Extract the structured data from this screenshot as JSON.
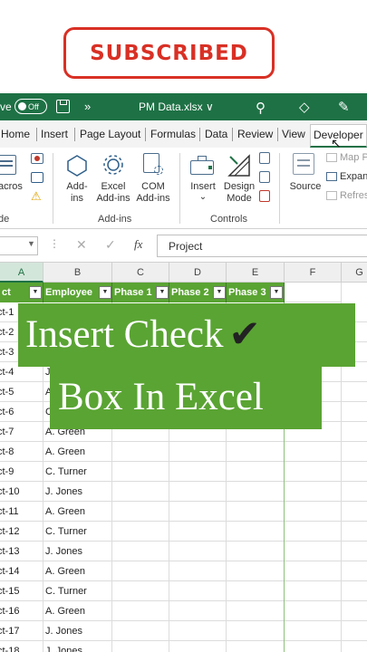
{
  "badge": {
    "label": "SUBSCRIBED"
  },
  "titlebar": {
    "autosave_fragment": "ve",
    "toggle_label": "Off",
    "more_label": "»",
    "filename": "PM Data.xlsx ∨"
  },
  "ribbon": {
    "tabs": [
      "Home",
      "Insert",
      "Page Layout",
      "Formulas",
      "Data",
      "Review",
      "View",
      "Developer"
    ],
    "active_tab": "Developer",
    "code": {
      "macros_fragment": "acros",
      "group_fragment": "de"
    },
    "addins": {
      "addins_label_1": "Add-",
      "addins_label_2": "ins",
      "excel_label_1": "Excel",
      "excel_label_2": "Add-ins",
      "com_label_1": "COM",
      "com_label_2": "Add-ins",
      "group_label": "Add-ins"
    },
    "controls": {
      "insert_label": "Insert",
      "insert_caret": "⌄",
      "design_label_1": "Design",
      "design_label_2": "Mode",
      "group_label": "Controls"
    },
    "xml": {
      "source_label": "Source",
      "map_label": "Map P",
      "expand_label": "Expan",
      "refresh_label": "Refres"
    }
  },
  "formula_bar": {
    "value": "Project",
    "fx": "fx"
  },
  "columns": [
    "A",
    "B",
    "C",
    "D",
    "E",
    "F",
    "G"
  ],
  "table_headers": [
    "ct",
    "Employee",
    "Phase 1",
    "Phase 2",
    "Phase 3"
  ],
  "rows": [
    {
      "a": "ct-1",
      "b": ""
    },
    {
      "a": "ct-2",
      "b": ""
    },
    {
      "a": "ct-3",
      "b": ""
    },
    {
      "a": "ct-4",
      "b": "J"
    },
    {
      "a": "ct-5",
      "b": "A"
    },
    {
      "a": "ct-6",
      "b": "C"
    },
    {
      "a": "ct-7",
      "b": "A. Green"
    },
    {
      "a": "ct-8",
      "b": "A. Green"
    },
    {
      "a": "ct-9",
      "b": "C. Turner"
    },
    {
      "a": "ct-10",
      "b": "J. Jones"
    },
    {
      "a": "ct-11",
      "b": "A. Green"
    },
    {
      "a": "ct-12",
      "b": "C. Turner"
    },
    {
      "a": "ct-13",
      "b": "J. Jones"
    },
    {
      "a": "ct-14",
      "b": "A. Green"
    },
    {
      "a": "ct-15",
      "b": "C. Turner"
    },
    {
      "a": "ct-16",
      "b": "A. Green"
    },
    {
      "a": "ct-17",
      "b": "J. Jones"
    },
    {
      "a": "ct-18",
      "b": "J. Jones"
    }
  ],
  "caption": {
    "line1": "Insert Check",
    "tick": "✔",
    "line2": "Box In Excel"
  }
}
